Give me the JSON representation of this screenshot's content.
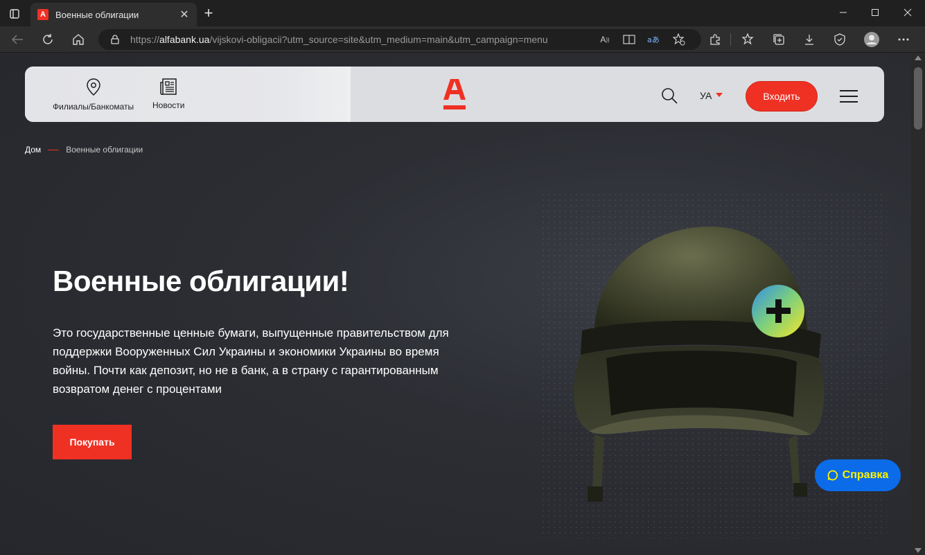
{
  "browser": {
    "tab_title": "Военные облигации",
    "tab_favicon_letter": "А",
    "url_scheme": "https://",
    "url_host": "alfabank.ua",
    "url_path": "/vijskovi-obligacii?utm_source=site&utm_medium=main&utm_campaign=menu"
  },
  "header": {
    "branches_label": "Филиалы/Банкоматы",
    "news_label": "Новости",
    "lang_label": "УА",
    "login_label": "Входить"
  },
  "breadcrumb": {
    "home": "Дом",
    "current": "Военные облигации"
  },
  "hero": {
    "title": "Военные облигации!",
    "text": "Это государственные ценные бумаги, выпущенные правительством для поддержки Вооруженных Сил Украины и экономики Украины во время войны. Почти как депозит, но не в банк, а в страну с гарантированным возвратом денег с процентами",
    "buy_label": "Покупать"
  },
  "help": {
    "label": "Справка"
  },
  "colors": {
    "brand_red": "#ef3124",
    "help_blue": "#0b6be8",
    "help_text": "#fff200"
  }
}
